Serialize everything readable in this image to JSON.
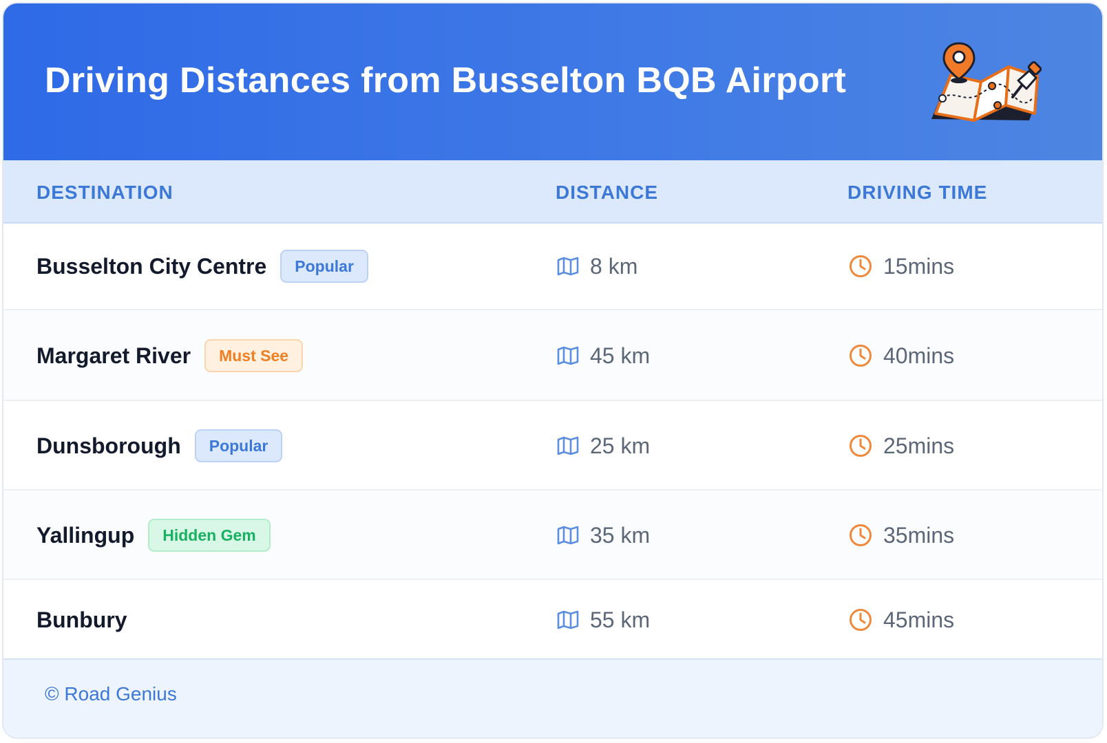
{
  "header": {
    "title": "Driving Distances from Busselton BQB Airport",
    "illustration": "folded-map-with-location-pin-icon"
  },
  "table": {
    "columns": [
      "DESTINATION",
      "DISTANCE",
      "DRIVING TIME"
    ],
    "rows": [
      {
        "destination": "Busselton City Centre",
        "badge": "Popular",
        "badge_color": "#3b78d8",
        "distance": "8 km",
        "time": "15mins"
      },
      {
        "destination": "Margaret River",
        "badge": "Must See",
        "badge_color": "#ee7f22",
        "distance": "45 km",
        "time": "40mins"
      },
      {
        "destination": "Dunsborough",
        "badge": "Popular",
        "badge_color": "#3b78d8",
        "distance": "25 km",
        "time": "25mins"
      },
      {
        "destination": "Yallingup",
        "badge": "Hidden Gem",
        "badge_color": "#19b063",
        "distance": "35 km",
        "time": "35mins"
      },
      {
        "destination": "Bunbury",
        "badge": "",
        "badge_color": "",
        "distance": "55 km",
        "time": "45mins"
      }
    ],
    "icons": {
      "distance": "map-icon",
      "time": "clock-icon"
    }
  },
  "footer": {
    "copyright": "© Road Genius"
  },
  "colors": {
    "header_gradient_start": "#2f6ae7",
    "header_gradient_end": "#4d85e2",
    "accent_blue": "#3b78d8",
    "accent_orange": "#ee7f22",
    "accent_green": "#19b063",
    "header_row_bg": "#dce8fb",
    "footer_bg": "#eef4fd"
  }
}
